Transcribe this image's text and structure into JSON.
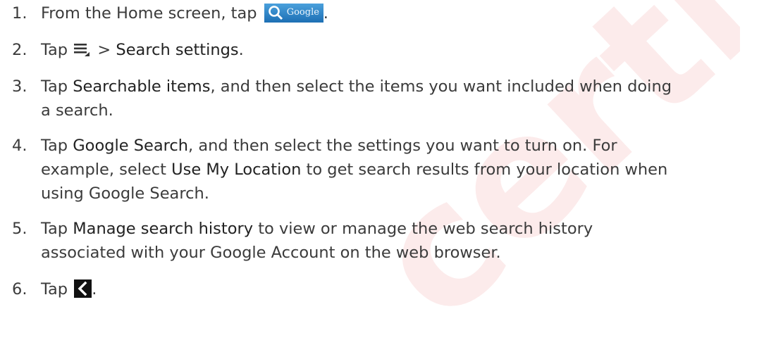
{
  "watermark": {
    "text": "certificate",
    "color": "#e03a3a"
  },
  "steps": [
    {
      "num": "1.",
      "lines": [
        {
          "before": "From the Home screen, tap ",
          "after": "."
        }
      ]
    },
    {
      "num": "2.",
      "lines": [
        {
          "before": "Tap ",
          "bold": "Search settings",
          "after": "."
        }
      ]
    },
    {
      "num": "3.",
      "lines": [
        {
          "before": "Tap ",
          "bold": "Searchable items",
          "after": ", and then select the items you want included when doing"
        },
        {
          "text": "a search."
        }
      ]
    },
    {
      "num": "4.",
      "lines": [
        {
          "before": "Tap ",
          "bold": "Google Search",
          "after": ", and then select the settings you want to turn on. For"
        },
        {
          "before": "example, select ",
          "bold": "Use My Location",
          "after": " to get search results from your location when"
        },
        {
          "text": "using Google Search."
        }
      ]
    },
    {
      "num": "5.",
      "lines": [
        {
          "before": "Tap ",
          "bold": "Manage search history",
          "after": " to view or manage the web search history"
        },
        {
          "text": "associated with your Google Account on the web browser."
        }
      ]
    },
    {
      "num": "6.",
      "lines": [
        {
          "before": "Tap ",
          "after": "."
        }
      ]
    }
  ],
  "icons": {
    "google_search_button": {
      "name": "google-search-button",
      "label": "Google"
    },
    "menu": {
      "name": "menu-icon",
      "suffix": " > "
    },
    "back": {
      "name": "back-icon"
    }
  }
}
